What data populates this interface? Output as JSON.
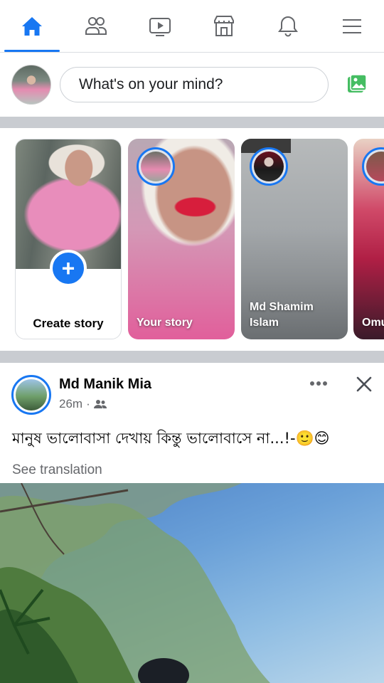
{
  "nav": {
    "tabs": [
      {
        "name": "home",
        "icon": "home-icon",
        "active": true
      },
      {
        "name": "friends",
        "icon": "friends-icon",
        "active": false
      },
      {
        "name": "watch",
        "icon": "video-icon",
        "active": false
      },
      {
        "name": "marketplace",
        "icon": "marketplace-icon",
        "active": false
      },
      {
        "name": "notifications",
        "icon": "bell-icon",
        "active": false
      },
      {
        "name": "menu",
        "icon": "hamburger-menu-icon",
        "active": false
      }
    ],
    "accent_color": "#1877f2"
  },
  "composer": {
    "placeholder": "What's on your mind?",
    "photo_icon": "photo-icon",
    "photo_icon_color": "#45bd62"
  },
  "stories": [
    {
      "label": "Create story",
      "type": "create"
    },
    {
      "label": "Your story",
      "type": "own"
    },
    {
      "label": "Md Shamim Islam",
      "type": "friend"
    },
    {
      "label": "Omu",
      "type": "friend"
    }
  ],
  "post": {
    "author": "Md Manik Mia",
    "time": "26m",
    "audience_icon": "friends-audience-icon",
    "text": "মানুষ ভালোবাসা দেখায় কিন্তু ভালোবাসে না...!-🙂😊",
    "see_translation": "See translation"
  }
}
